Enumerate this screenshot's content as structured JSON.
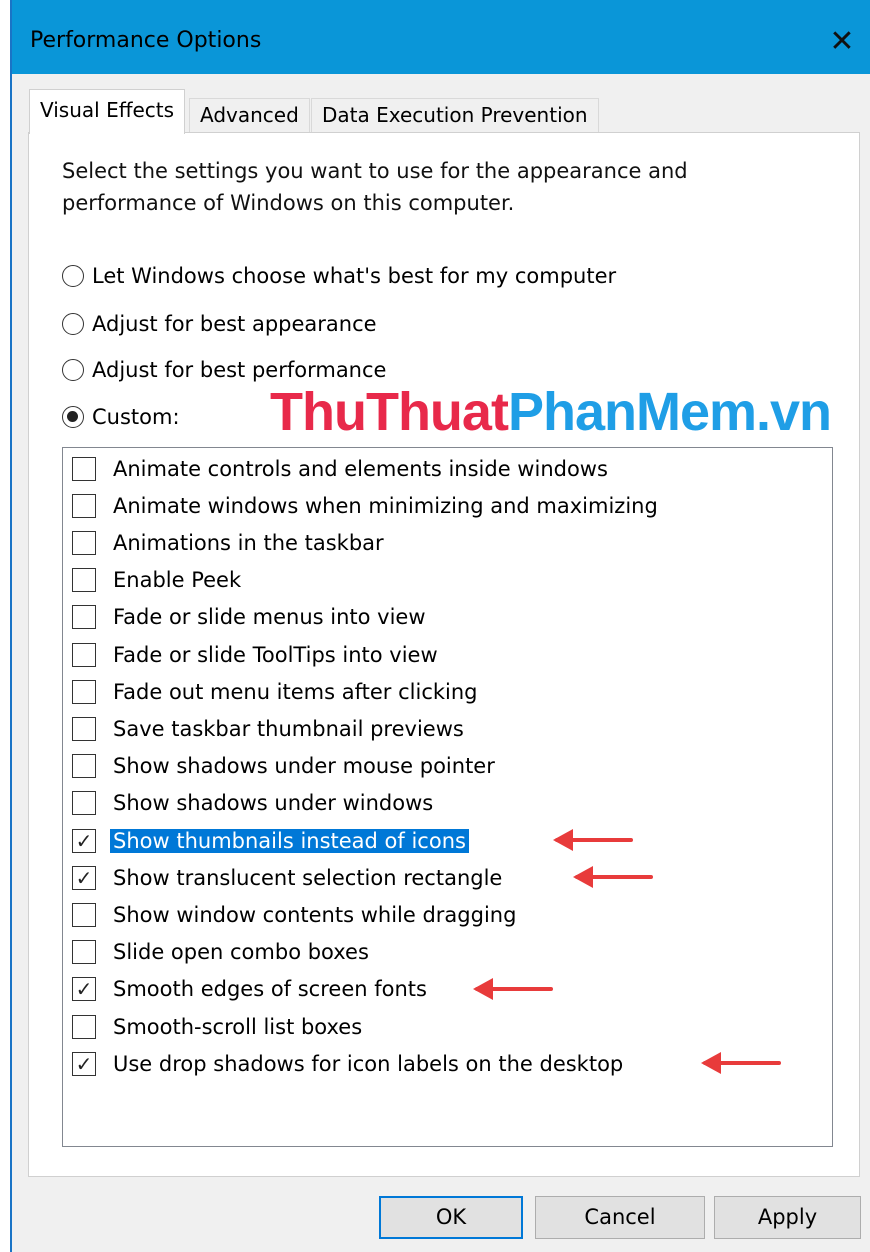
{
  "window": {
    "title": "Performance Options",
    "close_glyph": "✕"
  },
  "tabs": [
    {
      "label": "Visual Effects",
      "active": true
    },
    {
      "label": "Advanced",
      "active": false
    },
    {
      "label": "Data Execution Prevention",
      "active": false
    }
  ],
  "description": "Select the settings you want to use for the appearance and performance of Windows on this computer.",
  "radio_options": [
    {
      "label": "Let Windows choose what's best for my computer",
      "selected": false
    },
    {
      "label": "Adjust for best appearance",
      "selected": false
    },
    {
      "label": "Adjust for best performance",
      "selected": false
    },
    {
      "label": "Custom:",
      "selected": true
    }
  ],
  "watermark": {
    "part1": "ThuThuat",
    "part2": "PhanMem.vn",
    "color1": "#e8294a",
    "color2": "#1f9ee6"
  },
  "effects": [
    {
      "label": "Animate controls and elements inside windows",
      "checked": false
    },
    {
      "label": "Animate windows when minimizing and maximizing",
      "checked": false
    },
    {
      "label": "Animations in the taskbar",
      "checked": false
    },
    {
      "label": "Enable Peek",
      "checked": false
    },
    {
      "label": "Fade or slide menus into view",
      "checked": false
    },
    {
      "label": "Fade or slide ToolTips into view",
      "checked": false
    },
    {
      "label": "Fade out menu items after clicking",
      "checked": false
    },
    {
      "label": "Save taskbar thumbnail previews",
      "checked": false
    },
    {
      "label": "Show shadows under mouse pointer",
      "checked": false
    },
    {
      "label": "Show shadows under windows",
      "checked": false
    },
    {
      "label": "Show thumbnails instead of icons",
      "checked": true,
      "selected": true,
      "arrow": true
    },
    {
      "label": "Show translucent selection rectangle",
      "checked": true,
      "arrow": true
    },
    {
      "label": "Show window contents while dragging",
      "checked": false
    },
    {
      "label": "Slide open combo boxes",
      "checked": false
    },
    {
      "label": "Smooth edges of screen fonts",
      "checked": true,
      "arrow": true
    },
    {
      "label": "Smooth-scroll list boxes",
      "checked": false
    },
    {
      "label": "Use drop shadows for icon labels on the desktop",
      "checked": true,
      "arrow": true
    }
  ],
  "buttons": {
    "ok": "OK",
    "cancel": "Cancel",
    "apply": "Apply"
  },
  "colors": {
    "titlebar": "#0a96d8",
    "selection": "#0078d7",
    "arrow": "#e83b3b"
  }
}
